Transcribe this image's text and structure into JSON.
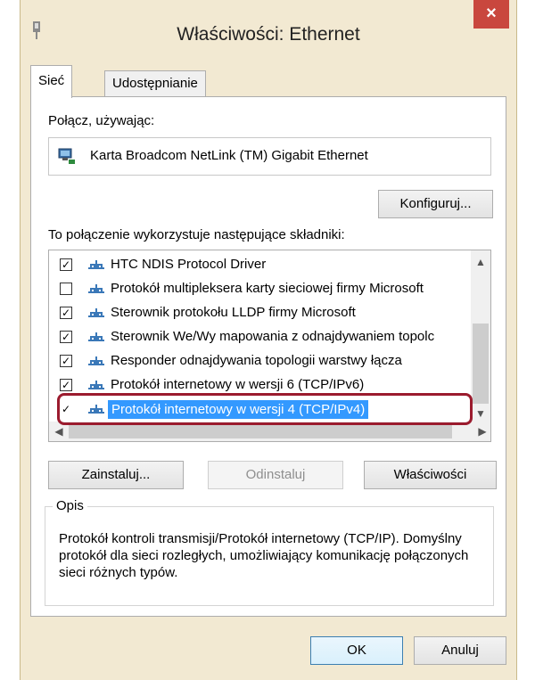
{
  "window": {
    "title": "Właściwości: Ethernet",
    "close": "×"
  },
  "tabs": [
    {
      "label": "Sieć",
      "active": true
    },
    {
      "label": "Udostępnianie",
      "active": false
    }
  ],
  "connect": {
    "label": "Połącz, używając:",
    "adapter_name": "Karta Broadcom NetLink (TM) Gigabit Ethernet",
    "configure_label": "Konfiguruj..."
  },
  "components": {
    "label": "To połączenie wykorzystuje następujące składniki:",
    "items": [
      {
        "label": "HTC NDIS Protocol Driver",
        "checked": true,
        "selected": false
      },
      {
        "label": "Protokół multipleksera karty sieciowej firmy Microsoft",
        "checked": false,
        "selected": false
      },
      {
        "label": "Sterownik protokołu LLDP firmy Microsoft",
        "checked": true,
        "selected": false
      },
      {
        "label": "Sterownik We/Wy mapowania z odnajdywaniem topolc",
        "checked": true,
        "selected": false
      },
      {
        "label": "Responder odnajdywania topologii warstwy łącza",
        "checked": true,
        "selected": false
      },
      {
        "label": "Protokół internetowy w wersji 6 (TCP/IPv6)",
        "checked": true,
        "selected": false
      },
      {
        "label": "Protokół internetowy w wersji 4 (TCP/IPv4)",
        "checked": true,
        "selected": true
      }
    ]
  },
  "buttons": {
    "install": "Zainstaluj...",
    "uninstall": "Odinstaluj",
    "properties": "Właściwości",
    "ok": "OK",
    "cancel": "Anuluj"
  },
  "description": {
    "title": "Opis",
    "text": "Protokół kontroli transmisji/Protokół internetowy (TCP/IP). Domyślny protokół dla sieci rozległych, umożliwiający komunikację połączonych sieci różnych typów."
  },
  "colors": {
    "accent_frame": "#f2e9d2",
    "close_red": "#c9473e",
    "selection": "#3399ff",
    "callout": "#9b1b2e"
  }
}
